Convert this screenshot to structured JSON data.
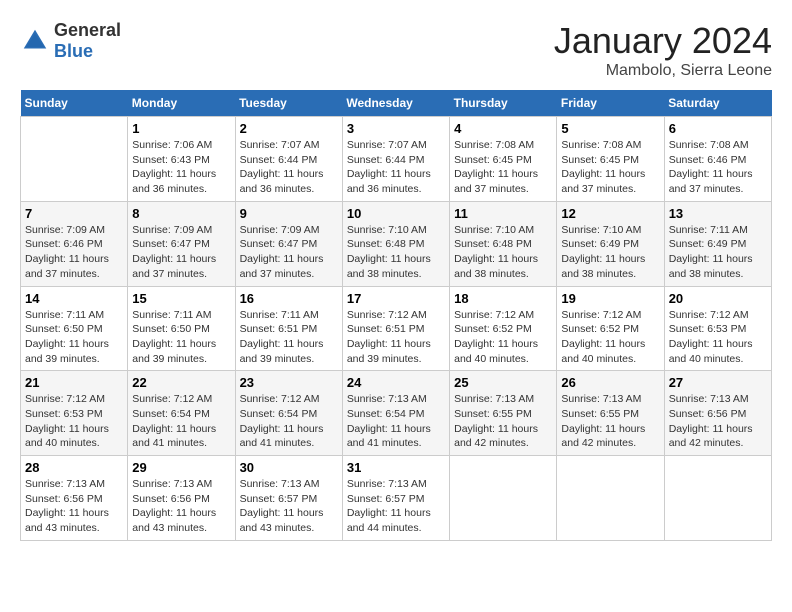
{
  "header": {
    "logo_general": "General",
    "logo_blue": "Blue",
    "month": "January 2024",
    "location": "Mambolo, Sierra Leone"
  },
  "days_of_week": [
    "Sunday",
    "Monday",
    "Tuesday",
    "Wednesday",
    "Thursday",
    "Friday",
    "Saturday"
  ],
  "weeks": [
    [
      {
        "day": "",
        "sunrise": "",
        "sunset": "",
        "daylight": ""
      },
      {
        "day": "1",
        "sunrise": "Sunrise: 7:06 AM",
        "sunset": "Sunset: 6:43 PM",
        "daylight": "Daylight: 11 hours and 36 minutes."
      },
      {
        "day": "2",
        "sunrise": "Sunrise: 7:07 AM",
        "sunset": "Sunset: 6:44 PM",
        "daylight": "Daylight: 11 hours and 36 minutes."
      },
      {
        "day": "3",
        "sunrise": "Sunrise: 7:07 AM",
        "sunset": "Sunset: 6:44 PM",
        "daylight": "Daylight: 11 hours and 36 minutes."
      },
      {
        "day": "4",
        "sunrise": "Sunrise: 7:08 AM",
        "sunset": "Sunset: 6:45 PM",
        "daylight": "Daylight: 11 hours and 37 minutes."
      },
      {
        "day": "5",
        "sunrise": "Sunrise: 7:08 AM",
        "sunset": "Sunset: 6:45 PM",
        "daylight": "Daylight: 11 hours and 37 minutes."
      },
      {
        "day": "6",
        "sunrise": "Sunrise: 7:08 AM",
        "sunset": "Sunset: 6:46 PM",
        "daylight": "Daylight: 11 hours and 37 minutes."
      }
    ],
    [
      {
        "day": "7",
        "sunrise": "Sunrise: 7:09 AM",
        "sunset": "Sunset: 6:46 PM",
        "daylight": "Daylight: 11 hours and 37 minutes."
      },
      {
        "day": "8",
        "sunrise": "Sunrise: 7:09 AM",
        "sunset": "Sunset: 6:47 PM",
        "daylight": "Daylight: 11 hours and 37 minutes."
      },
      {
        "day": "9",
        "sunrise": "Sunrise: 7:09 AM",
        "sunset": "Sunset: 6:47 PM",
        "daylight": "Daylight: 11 hours and 37 minutes."
      },
      {
        "day": "10",
        "sunrise": "Sunrise: 7:10 AM",
        "sunset": "Sunset: 6:48 PM",
        "daylight": "Daylight: 11 hours and 38 minutes."
      },
      {
        "day": "11",
        "sunrise": "Sunrise: 7:10 AM",
        "sunset": "Sunset: 6:48 PM",
        "daylight": "Daylight: 11 hours and 38 minutes."
      },
      {
        "day": "12",
        "sunrise": "Sunrise: 7:10 AM",
        "sunset": "Sunset: 6:49 PM",
        "daylight": "Daylight: 11 hours and 38 minutes."
      },
      {
        "day": "13",
        "sunrise": "Sunrise: 7:11 AM",
        "sunset": "Sunset: 6:49 PM",
        "daylight": "Daylight: 11 hours and 38 minutes."
      }
    ],
    [
      {
        "day": "14",
        "sunrise": "Sunrise: 7:11 AM",
        "sunset": "Sunset: 6:50 PM",
        "daylight": "Daylight: 11 hours and 39 minutes."
      },
      {
        "day": "15",
        "sunrise": "Sunrise: 7:11 AM",
        "sunset": "Sunset: 6:50 PM",
        "daylight": "Daylight: 11 hours and 39 minutes."
      },
      {
        "day": "16",
        "sunrise": "Sunrise: 7:11 AM",
        "sunset": "Sunset: 6:51 PM",
        "daylight": "Daylight: 11 hours and 39 minutes."
      },
      {
        "day": "17",
        "sunrise": "Sunrise: 7:12 AM",
        "sunset": "Sunset: 6:51 PM",
        "daylight": "Daylight: 11 hours and 39 minutes."
      },
      {
        "day": "18",
        "sunrise": "Sunrise: 7:12 AM",
        "sunset": "Sunset: 6:52 PM",
        "daylight": "Daylight: 11 hours and 40 minutes."
      },
      {
        "day": "19",
        "sunrise": "Sunrise: 7:12 AM",
        "sunset": "Sunset: 6:52 PM",
        "daylight": "Daylight: 11 hours and 40 minutes."
      },
      {
        "day": "20",
        "sunrise": "Sunrise: 7:12 AM",
        "sunset": "Sunset: 6:53 PM",
        "daylight": "Daylight: 11 hours and 40 minutes."
      }
    ],
    [
      {
        "day": "21",
        "sunrise": "Sunrise: 7:12 AM",
        "sunset": "Sunset: 6:53 PM",
        "daylight": "Daylight: 11 hours and 40 minutes."
      },
      {
        "day": "22",
        "sunrise": "Sunrise: 7:12 AM",
        "sunset": "Sunset: 6:54 PM",
        "daylight": "Daylight: 11 hours and 41 minutes."
      },
      {
        "day": "23",
        "sunrise": "Sunrise: 7:12 AM",
        "sunset": "Sunset: 6:54 PM",
        "daylight": "Daylight: 11 hours and 41 minutes."
      },
      {
        "day": "24",
        "sunrise": "Sunrise: 7:13 AM",
        "sunset": "Sunset: 6:54 PM",
        "daylight": "Daylight: 11 hours and 41 minutes."
      },
      {
        "day": "25",
        "sunrise": "Sunrise: 7:13 AM",
        "sunset": "Sunset: 6:55 PM",
        "daylight": "Daylight: 11 hours and 42 minutes."
      },
      {
        "day": "26",
        "sunrise": "Sunrise: 7:13 AM",
        "sunset": "Sunset: 6:55 PM",
        "daylight": "Daylight: 11 hours and 42 minutes."
      },
      {
        "day": "27",
        "sunrise": "Sunrise: 7:13 AM",
        "sunset": "Sunset: 6:56 PM",
        "daylight": "Daylight: 11 hours and 42 minutes."
      }
    ],
    [
      {
        "day": "28",
        "sunrise": "Sunrise: 7:13 AM",
        "sunset": "Sunset: 6:56 PM",
        "daylight": "Daylight: 11 hours and 43 minutes."
      },
      {
        "day": "29",
        "sunrise": "Sunrise: 7:13 AM",
        "sunset": "Sunset: 6:56 PM",
        "daylight": "Daylight: 11 hours and 43 minutes."
      },
      {
        "day": "30",
        "sunrise": "Sunrise: 7:13 AM",
        "sunset": "Sunset: 6:57 PM",
        "daylight": "Daylight: 11 hours and 43 minutes."
      },
      {
        "day": "31",
        "sunrise": "Sunrise: 7:13 AM",
        "sunset": "Sunset: 6:57 PM",
        "daylight": "Daylight: 11 hours and 44 minutes."
      },
      {
        "day": "",
        "sunrise": "",
        "sunset": "",
        "daylight": ""
      },
      {
        "day": "",
        "sunrise": "",
        "sunset": "",
        "daylight": ""
      },
      {
        "day": "",
        "sunrise": "",
        "sunset": "",
        "daylight": ""
      }
    ]
  ]
}
